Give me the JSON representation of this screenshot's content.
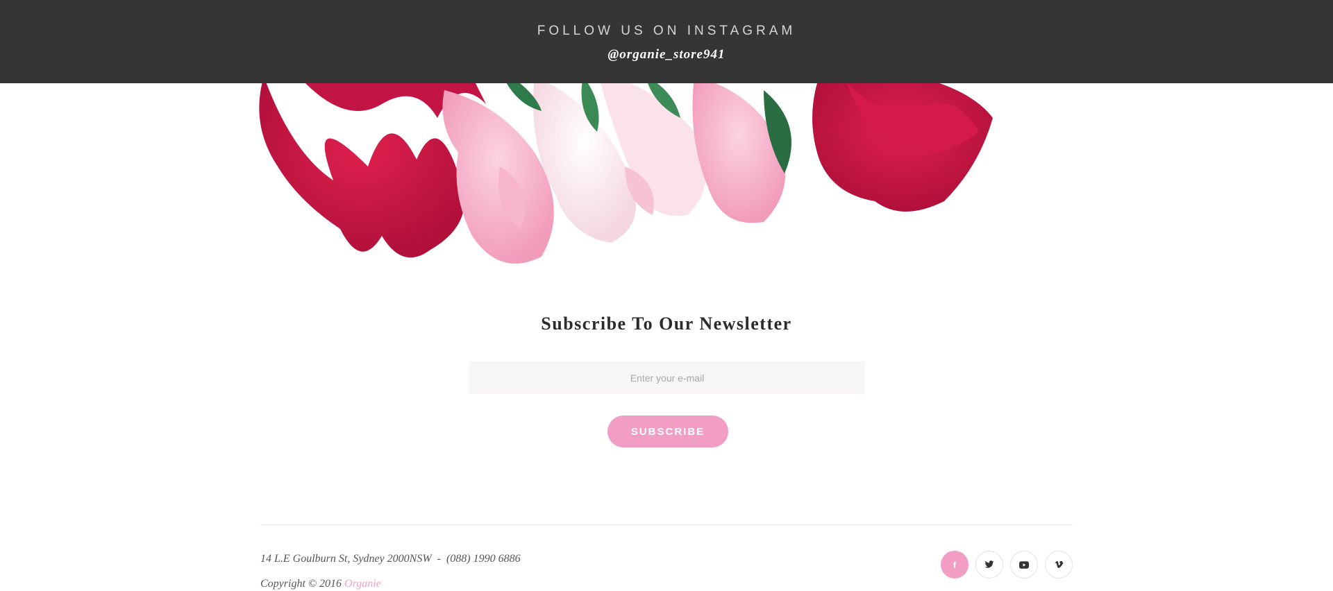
{
  "instagram": {
    "title": "FOLLOW US ON INSTAGRAM",
    "handle": "@organie_store941"
  },
  "newsletter": {
    "title": "Subscribe To Our Newsletter",
    "email_placeholder": "Enter your e-mail",
    "subscribe_label": "SUBSCRIBE"
  },
  "footer": {
    "address": "14 L.E Goulburn St, Sydney 2000NSW  -  (088) 1990 6886",
    "copyright_prefix": "Copyright © 2016 ",
    "brand": "Organie",
    "socials": [
      {
        "icon": "facebook-icon",
        "active": true
      },
      {
        "icon": "twitter-icon",
        "active": false
      },
      {
        "icon": "youtube-icon",
        "active": false
      },
      {
        "icon": "vimeo-icon",
        "active": false
      }
    ]
  },
  "colors": {
    "accent": "#f29ec4",
    "dark_bar": "#353535",
    "input_bg": "#f7f5f6"
  }
}
